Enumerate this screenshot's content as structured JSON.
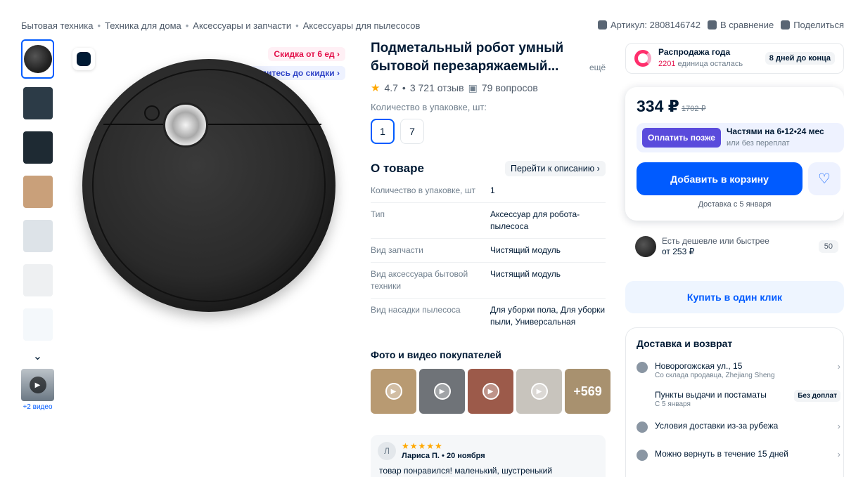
{
  "breadcrumbs": [
    "Бытовая техника",
    "Техника для дома",
    "Аксессуары и запчасти",
    "Аксессуары для пылесосов"
  ],
  "topmeta": {
    "article": "Артикул: 2808146742",
    "compare": "В сравнение",
    "share": "Поделиться"
  },
  "gallery": {
    "videos_label": "+2 видео",
    "discount_badge": "Скидка от 6 ед",
    "wait_badge": "Дождитесь до скидки"
  },
  "product": {
    "title": "Подметальный робот умный бытовой перезаряжаемый...",
    "more": "ещё",
    "rating": "4.7",
    "reviews": "3 721 отзыв",
    "questions": "79 вопросов",
    "qty_label": "Количество в упаковке, шт:",
    "qty_options": [
      "1",
      "7"
    ]
  },
  "about": {
    "heading": "О товаре",
    "goto": "Перейти к описанию",
    "specs": [
      {
        "key": "Количество в упаковке, шт",
        "value": "1"
      },
      {
        "key": "Тип",
        "value": "Аксессуар для робота-пылесоса"
      },
      {
        "key": "Вид запчасти",
        "value": "Чистящий модуль"
      },
      {
        "key": "Вид аксессуара бытовой техники",
        "value": "Чистящий модуль"
      },
      {
        "key": "Вид насадки пылесоса",
        "value": "Для уборки пола, Для уборки пыли, Универсальная"
      }
    ]
  },
  "photos": {
    "heading": "Фото и видео покупателей",
    "more": "+569"
  },
  "review": {
    "initial": "Л",
    "author": "Лариса П.",
    "date": "20 ноября",
    "stars": "★★★★★",
    "text": "товар понравился! маленький, шустренький"
  },
  "sale": {
    "title": "Распродажа года",
    "left_count": "2201",
    "left_text": "единица осталась",
    "days": "8 дней до конца"
  },
  "buy": {
    "price": "334 ₽",
    "old_price": "1702 ₽",
    "paylater_btn": "Оплатить позже",
    "parts": "Частями на 6•12•24 мес",
    "parts_sub": "или без переплат",
    "cart": "Добавить в корзину",
    "delivery": "Доставка с 5 января"
  },
  "cheaper": {
    "text": "Есть дешевле или быстрее",
    "price": "от 253 ₽",
    "count": "50"
  },
  "oneclick": "Купить в один клик",
  "delivery_box": {
    "heading": "Доставка и возврат",
    "address": "Новорогожская ул., 15",
    "address_sub": "Со склада продавца, Zhejiang Sheng",
    "pickup": "Пункты выдачи и постаматы",
    "pickup_sub": "С 5 января",
    "pickup_badge": "Без доплат",
    "abroad": "Условия доставки из-за рубежа",
    "return": "Можно вернуть в течение 15 дней"
  }
}
